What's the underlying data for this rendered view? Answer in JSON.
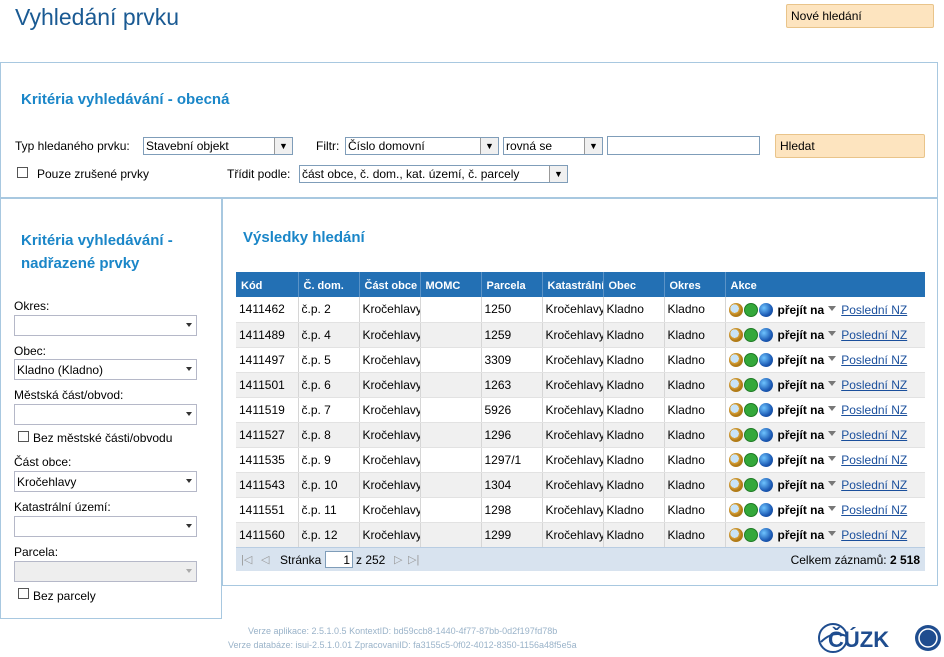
{
  "page": {
    "title": "Vyhledání prvku",
    "new_search_label": "Nové hledání"
  },
  "general_criteria": {
    "title": "Kritéria vyhledávání - obecná",
    "type_label": "Typ hledaného prvku:",
    "type_value": "Stavební objekt",
    "filter_label": "Filtr:",
    "filter_value": "Číslo domovní",
    "operator_value": "rovná se",
    "filter_input_value": "",
    "search_label": "Hledat",
    "only_cancelled_label": "Pouze zrušené prvky",
    "sort_label": "Třídit podle:",
    "sort_value": "část obce, č. dom., kat. území, č. parcely"
  },
  "parent_criteria": {
    "title_line1": "Kritéria vyhledávání -",
    "title_line2": "nadřazené prvky",
    "district_label": "Okres:",
    "district_value": "",
    "municipality_label": "Obec:",
    "municipality_value": "Kladno (Kladno)",
    "city_part_label": "Městská část/obvod:",
    "city_part_value": "",
    "no_city_part_label": "Bez městské části/obvodu",
    "municipality_part_label": "Část obce:",
    "municipality_part_value": "Kročehlavy",
    "cadastral_label": "Katastrální území:",
    "cadastral_value": "",
    "parcel_label": "Parcela:",
    "parcel_value": "",
    "no_parcel_label": "Bez parcely"
  },
  "results": {
    "title": "Výsledky hledání",
    "columns": [
      "Kód",
      "Č. dom.",
      "Část obce",
      "MOMC",
      "Parcela",
      "Katastrální",
      "Obec",
      "Okres",
      "Akce"
    ],
    "rows": [
      [
        "1411462",
        "č.p. 2",
        "Kročehlavy",
        "",
        "1250",
        "Kročehlavy",
        "Kladno",
        "Kladno"
      ],
      [
        "1411489",
        "č.p. 4",
        "Kročehlavy",
        "",
        "1259",
        "Kročehlavy",
        "Kladno",
        "Kladno"
      ],
      [
        "1411497",
        "č.p. 5",
        "Kročehlavy",
        "",
        "3309",
        "Kročehlavy",
        "Kladno",
        "Kladno"
      ],
      [
        "1411501",
        "č.p. 6",
        "Kročehlavy",
        "",
        "1263",
        "Kročehlavy",
        "Kladno",
        "Kladno"
      ],
      [
        "1411519",
        "č.p. 7",
        "Kročehlavy",
        "",
        "5926",
        "Kročehlavy",
        "Kladno",
        "Kladno"
      ],
      [
        "1411527",
        "č.p. 8",
        "Kročehlavy",
        "",
        "1296",
        "Kročehlavy",
        "Kladno",
        "Kladno"
      ],
      [
        "1411535",
        "č.p. 9",
        "Kročehlavy",
        "",
        "1297/1",
        "Kročehlavy",
        "Kladno",
        "Kladno"
      ],
      [
        "1411543",
        "č.p. 10",
        "Kročehlavy",
        "",
        "1304",
        "Kročehlavy",
        "Kladno",
        "Kladno"
      ],
      [
        "1411551",
        "č.p. 11",
        "Kročehlavy",
        "",
        "1298",
        "Kročehlavy",
        "Kladno",
        "Kladno"
      ],
      [
        "1411560",
        "č.p. 12",
        "Kročehlavy",
        "",
        "1299",
        "Kročehlavy",
        "Kladno",
        "Kladno"
      ]
    ],
    "action_goto_label": "přejít na",
    "action_link_label": "Poslední NZ",
    "action_icons": [
      "magnifier-icon",
      "check-icon",
      "globe-icon"
    ]
  },
  "pager": {
    "page_label": "Stránka",
    "page_value": "1",
    "of_label": "z 252",
    "total_label": "Celkem záznamů:",
    "total_value": "2 518"
  },
  "footer": {
    "line1": "Verze aplikace: 2.5.1.0.5 KontextID: bd59ccb8-1440-4f77-87bb-0d2f197fd78b",
    "line2": "Verze databáze: isui-2.5.1.0.01 ZpracovaniID: fa3155c5-0f02-4012-8350-1156a48f5e5a",
    "logo_text": "ČÚZK"
  },
  "colors": {
    "title": "#1a5a93",
    "panel_title": "#1a86c8",
    "header_bg": "#2370b4",
    "button_bg": "#fde4bf",
    "panel_border": "#a8c8e0"
  }
}
